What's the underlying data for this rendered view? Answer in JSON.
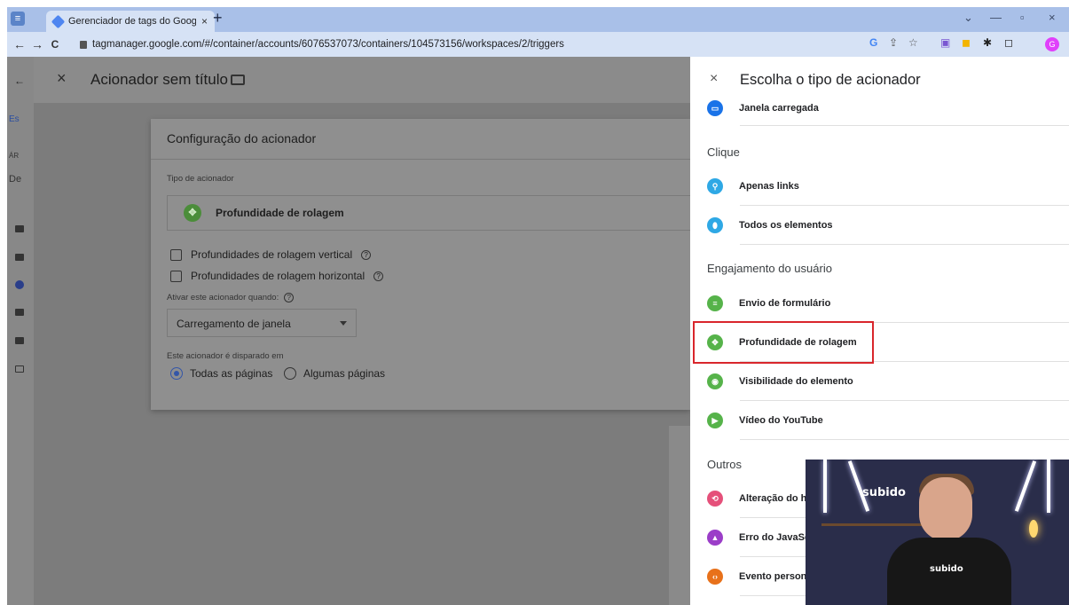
{
  "browser": {
    "tab_title": "Gerenciador de tags do Google",
    "tab_close": "×",
    "new_tab": "+",
    "url": "tagmanager.google.com/#/container/accounts/6076537073/containers/104573156/workspaces/2/triggers",
    "avatar_letter": "G",
    "nav_back": "←",
    "nav_forward": "→",
    "nav_reload": "C"
  },
  "editor": {
    "close": "×",
    "title": "Acionador sem título",
    "left_tab_fragments": [
      "Es",
      "ÁR",
      "De"
    ],
    "card_title": "Configuração do acionador",
    "type_label": "Tipo de acionador",
    "type_value": "Profundidade de rolagem",
    "checkbox_vertical": "Profundidades de rolagem vertical",
    "checkbox_horizontal": "Profundidades de rolagem horizontal",
    "activate_label": "Ativar este acionador quando:",
    "activate_value": "Carregamento de janela",
    "fires_on_label": "Este acionador é disparado em",
    "radio_all": "Todas as páginas",
    "radio_some": "Algumas páginas"
  },
  "panel": {
    "close": "×",
    "title": "Escolha o tipo de acionador",
    "top_item": "Janela carregada",
    "sections": {
      "click": "Clique",
      "engagement": "Engajamento do usuário",
      "other": "Outros"
    },
    "click_items": [
      "Apenas links",
      "Todos os elementos"
    ],
    "engagement_items": [
      "Envio de formulário",
      "Profundidade de rolagem",
      "Visibilidade do elemento",
      "Vídeo do YouTube"
    ],
    "other_items": [
      "Alteração do hi",
      "Erro do JavaSc",
      "Evento persona"
    ]
  },
  "webcam": {
    "neon_text": "subido",
    "shirt_text": "subido"
  }
}
